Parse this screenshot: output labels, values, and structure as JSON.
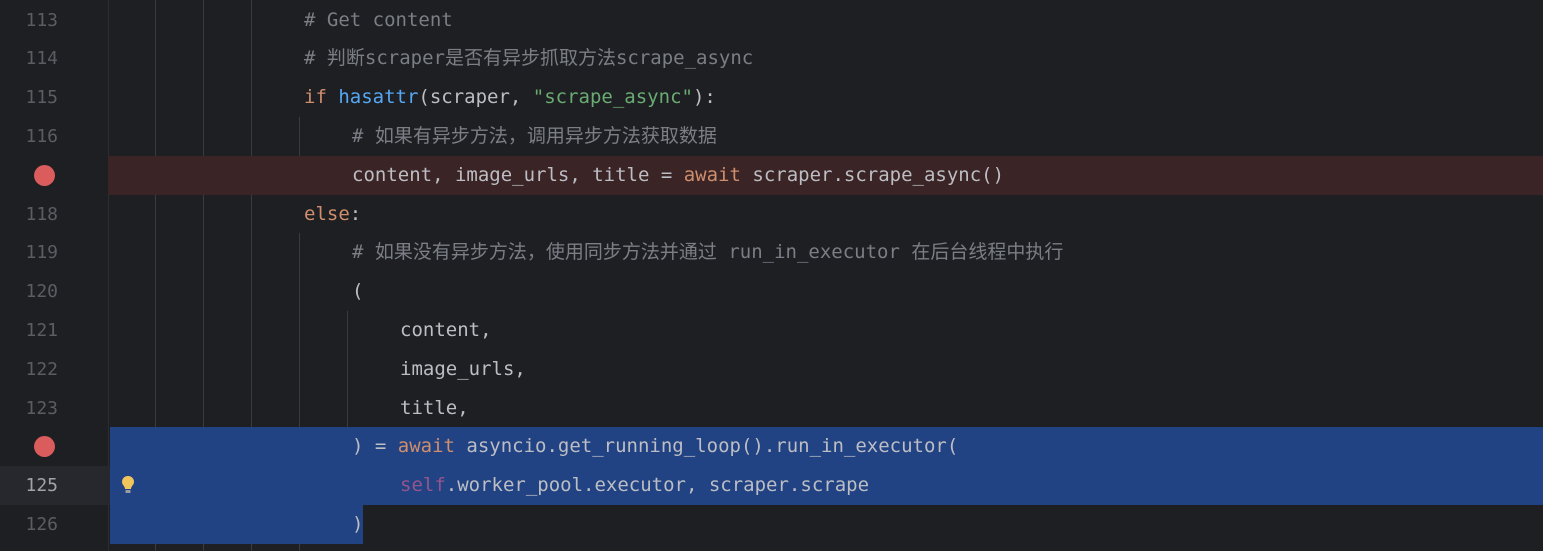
{
  "editor": {
    "lines": [
      {
        "num": "113",
        "indent": 1,
        "tokens": [
          {
            "t": "# Get content",
            "c": "c-comment"
          }
        ]
      },
      {
        "num": "114",
        "indent": 1,
        "tokens": [
          {
            "t": "# 判断scraper是否有异步抓取方法scrape_async",
            "c": "c-comment"
          }
        ]
      },
      {
        "num": "115",
        "indent": 1,
        "tokens": [
          {
            "t": "if ",
            "c": "c-kw"
          },
          {
            "t": "hasattr",
            "c": "c-fn"
          },
          {
            "t": "(scraper, ",
            "c": "c-def"
          },
          {
            "t": "\"scrape_async\"",
            "c": "c-str"
          },
          {
            "t": "):",
            "c": "c-def"
          }
        ]
      },
      {
        "num": "116",
        "indent": 2,
        "tokens": [
          {
            "t": "# 如果有异步方法，调用异步方法获取数据",
            "c": "c-comment"
          }
        ]
      },
      {
        "num": "",
        "indent": 2,
        "breakpoint": true,
        "tokens": [
          {
            "t": "content, image_urls, title = ",
            "c": "c-def"
          },
          {
            "t": "await ",
            "c": "c-kw"
          },
          {
            "t": "scraper.scrape_async()",
            "c": "c-def"
          }
        ]
      },
      {
        "num": "118",
        "indent": 1,
        "tokens": [
          {
            "t": "else",
            "c": "c-kw"
          },
          {
            "t": ":",
            "c": "c-def"
          }
        ]
      },
      {
        "num": "119",
        "indent": 2,
        "tokens": [
          {
            "t": "# 如果没有异步方法，使用同步方法并通过 run_in_executor 在后台线程中执行",
            "c": "c-comment"
          }
        ]
      },
      {
        "num": "120",
        "indent": 2,
        "tokens": [
          {
            "t": "(",
            "c": "c-def"
          }
        ]
      },
      {
        "num": "121",
        "indent": 3,
        "tokens": [
          {
            "t": "content,",
            "c": "c-def"
          }
        ]
      },
      {
        "num": "122",
        "indent": 3,
        "tokens": [
          {
            "t": "image_urls,",
            "c": "c-def"
          }
        ]
      },
      {
        "num": "123",
        "indent": 3,
        "tokens": [
          {
            "t": "title,",
            "c": "c-def"
          }
        ]
      },
      {
        "num": "",
        "indent": 2,
        "breakpoint": true,
        "tokens": [
          {
            "t": ") = ",
            "c": "c-def"
          },
          {
            "t": "await ",
            "c": "c-kw"
          },
          {
            "t": "asyncio.get_running_loop().run_in_executor(",
            "c": "c-def"
          }
        ]
      },
      {
        "num": "125",
        "indent": 3,
        "current": true,
        "bulb": true,
        "tokens": [
          {
            "t": "self",
            "c": "c-self"
          },
          {
            "t": ".worker_pool.executor, scraper.scrape",
            "c": "c-def"
          }
        ]
      },
      {
        "num": "126",
        "indent": 2,
        "tokens": [
          {
            "t": ")",
            "c": "c-def"
          }
        ]
      }
    ],
    "colors": {
      "background": "#1e1f22",
      "selection": "#214283",
      "breakpoint": "#db5c5c",
      "breakpoint_line": "#3a2425",
      "keyword": "#cf8e6d",
      "function": "#56a8f5",
      "string": "#6aab73",
      "comment": "#7a7e85",
      "self": "#94558d"
    },
    "icons": [
      "breakpoint-icon",
      "lightbulb-icon"
    ]
  }
}
